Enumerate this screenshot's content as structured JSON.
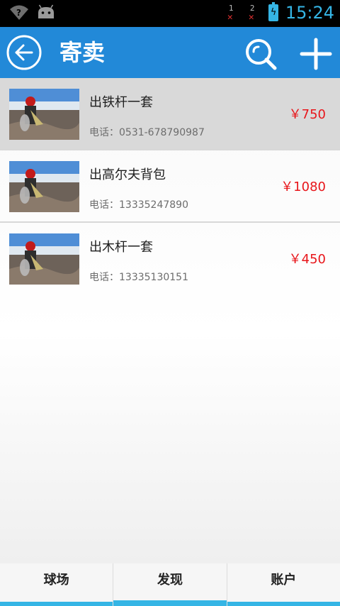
{
  "status_bar": {
    "left_icons": [
      "wifi-question-icon",
      "android-icon"
    ],
    "sim1": "1",
    "sim2": "2",
    "battery_icon": "battery-charging-icon",
    "time": "15:24"
  },
  "action_bar": {
    "title": "寄卖",
    "back_icon": "arrow-left-circle-icon",
    "search_icon": "search-icon",
    "add_icon": "plus-icon"
  },
  "items": [
    {
      "title": "出铁杆一套",
      "phone": "电话：0531-678790987",
      "price": "￥750",
      "selected": true
    },
    {
      "title": "出高尔夫背包",
      "phone": "电话：13335247890",
      "price": "￥1080",
      "selected": false
    },
    {
      "title": "出木杆一套",
      "phone": "电话：13335130151",
      "price": "￥450",
      "selected": false
    }
  ],
  "tabs": [
    {
      "label": "球场",
      "active": false
    },
    {
      "label": "发现",
      "active": true
    },
    {
      "label": "账户",
      "active": false
    }
  ],
  "colors": {
    "action_bar": "#2289d8",
    "accent": "#35b5e5",
    "price": "#e8161b"
  }
}
